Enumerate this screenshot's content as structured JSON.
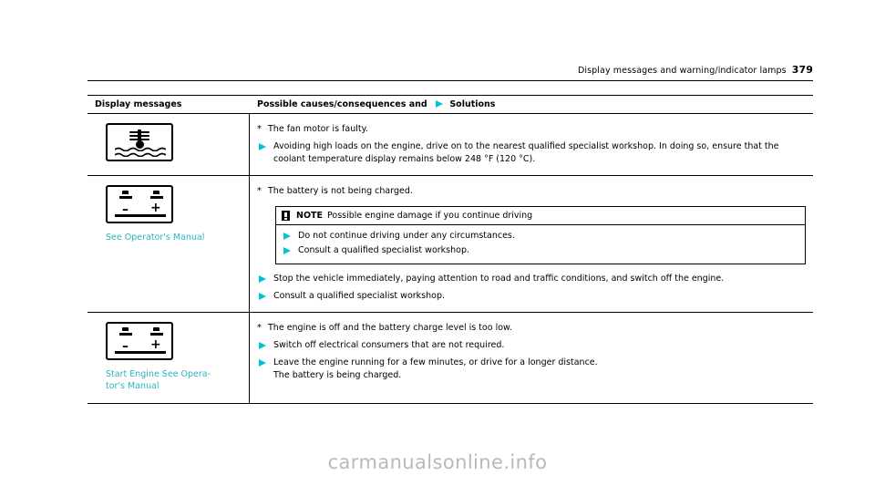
{
  "header": {
    "title": "Display messages and warning/indicator lamps",
    "page_number": "379"
  },
  "table": {
    "columns": {
      "col1": "Display messages",
      "col2_prefix": "Possible causes/consequences and",
      "col2_suffix": "Solutions"
    },
    "rows": [
      {
        "icon": "coolant-temperature-warning-symbol",
        "caption": "",
        "cause": "The fan motor is faulty.",
        "solutions": [
          "Avoiding high loads on the engine, drive on to the nearest qualified specialist workshop. In doing so, ensure that the coolant temperature display remains below 248 °F (120 °C)."
        ]
      },
      {
        "icon": "battery-warning-symbol",
        "caption": "See Operator's Manual",
        "cause": "The battery is not being charged.",
        "note": {
          "word": "NOTE",
          "text": "Possible engine damage if you continue driving",
          "items": [
            "Do not continue driving under any circumstances.",
            "Consult a qualified specialist workshop."
          ]
        },
        "solutions": [
          "Stop the vehicle immediately, paying attention to road and traffic conditions, and switch off the engine.",
          "Consult a qualified specialist workshop."
        ]
      },
      {
        "icon": "battery-warning-symbol",
        "caption": "Start Engine See Opera-\ntor's Manual",
        "cause": "The engine is off and the battery charge level is too low.",
        "solutions": [
          "Switch off electrical consumers that are not required.",
          "Leave the engine running for a few minutes, or drive for a longer distance.\nThe battery is being charged."
        ]
      }
    ]
  },
  "watermark": "carmanualsonline.info",
  "colors": {
    "accent_teal": "#2bb3c0",
    "arrow_cyan": "#00c2d6",
    "watermark_gray": "#b9b9b9"
  }
}
